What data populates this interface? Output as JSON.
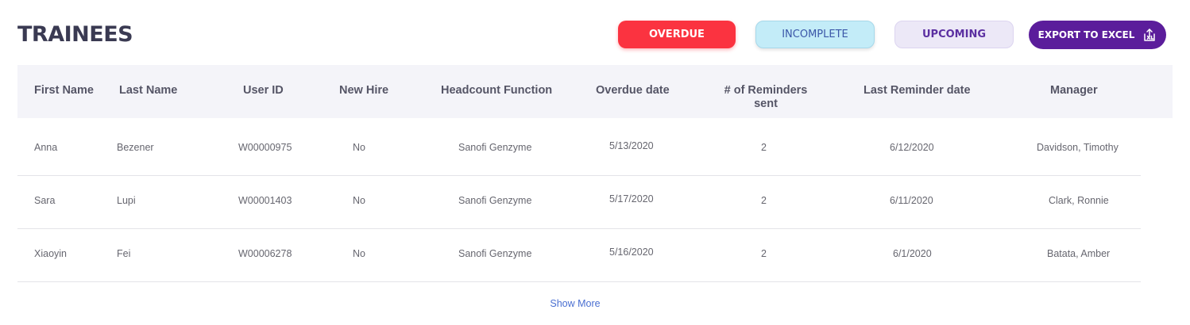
{
  "page": {
    "title": "TRAINEES"
  },
  "filters": {
    "overdue": "OVERDUE",
    "incomplete": "INCOMPLETE",
    "upcoming": "UPCOMING"
  },
  "export": {
    "label": "EXPORT TO EXCEL",
    "icon": "excel-export-icon"
  },
  "colors": {
    "overdue": "#fb3340",
    "incomplete": "#c3ecf8",
    "upcoming": "#ece8f7",
    "export": "#5b1d9b",
    "link": "#4a6fd1"
  },
  "table": {
    "headers": [
      "First Name",
      "Last Name",
      "User ID",
      "New Hire",
      "Headcount Function",
      "Overdue date",
      "# of Reminders sent",
      "Last Reminder date",
      "Manager"
    ],
    "rows": [
      [
        "Anna",
        "Bezener",
        "W00000975",
        "No",
        "Sanofi Genzyme",
        "5/13/2020",
        "2",
        "6/12/2020",
        "Davidson, Timothy"
      ],
      [
        "Sara",
        "Lupi",
        "W00001403",
        "No",
        "Sanofi Genzyme",
        "5/17/2020",
        "2",
        "6/11/2020",
        "Clark, Ronnie"
      ],
      [
        "Xiaoyin",
        "Fei",
        "W00006278",
        "No",
        "Sanofi Genzyme",
        "5/16/2020",
        "2",
        "6/1/2020",
        "Batata, Amber"
      ]
    ]
  },
  "pagination": {
    "show_more": "Show More"
  }
}
